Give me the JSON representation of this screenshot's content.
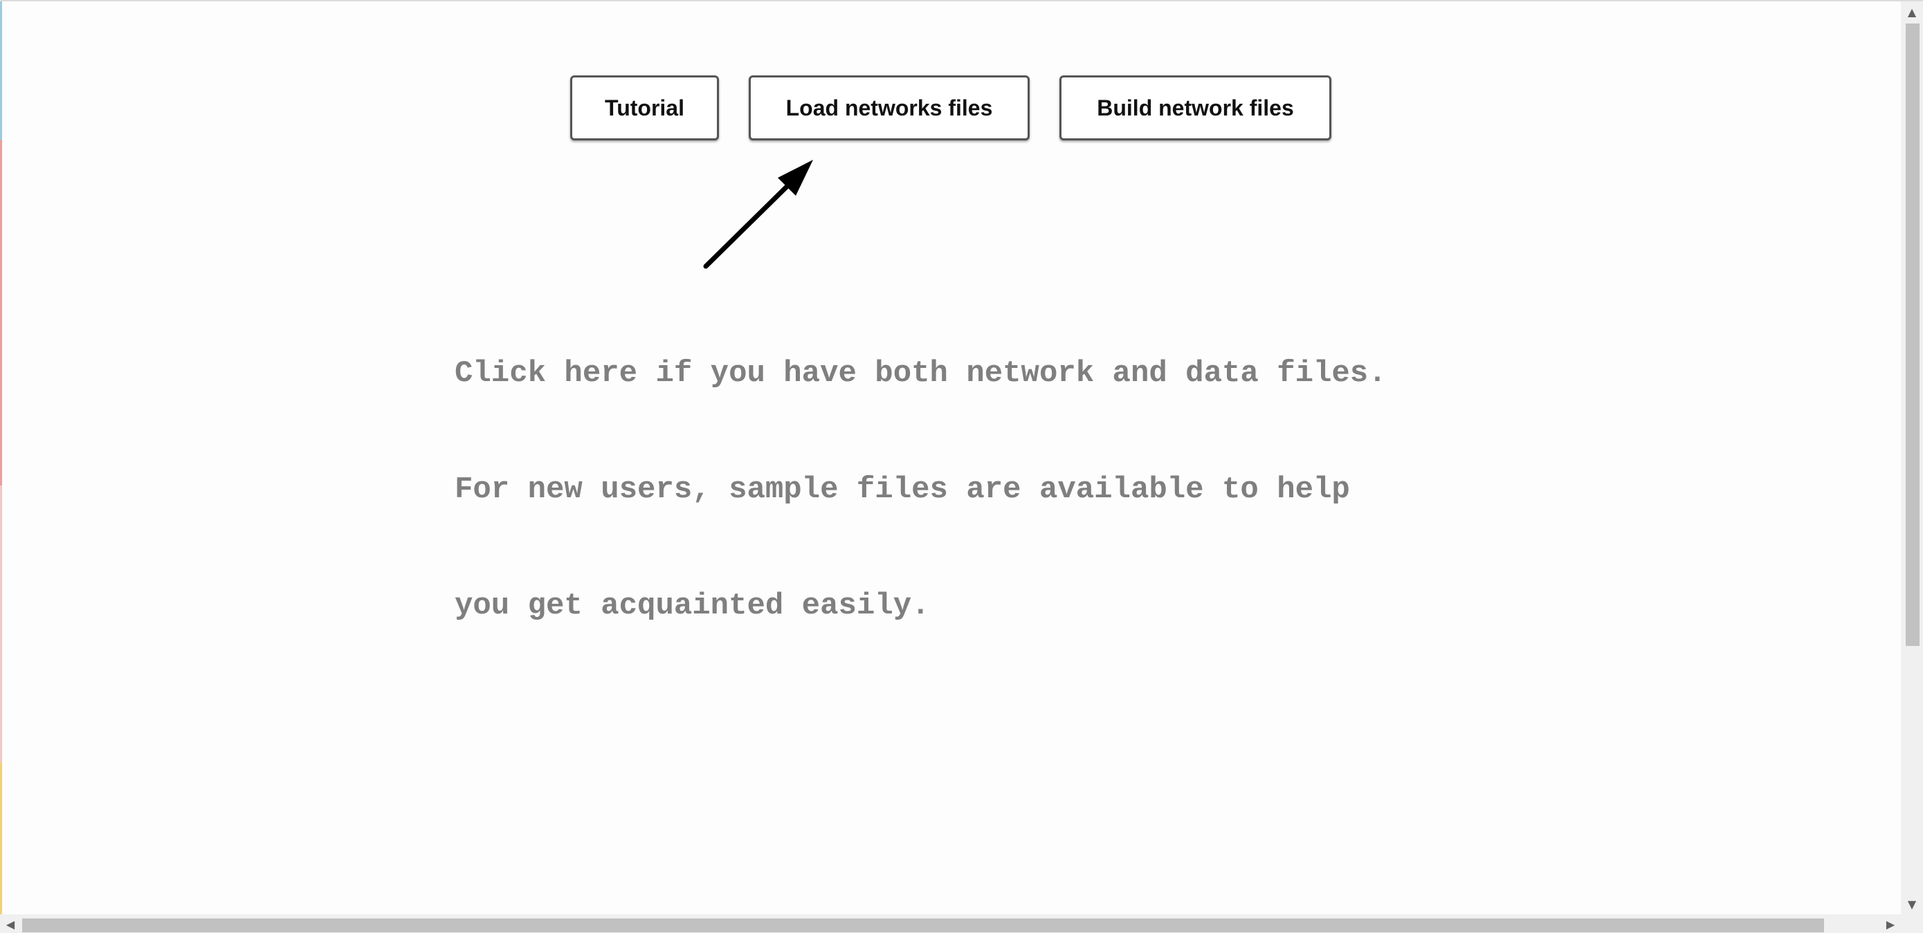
{
  "toolbar": {
    "tutorial_label": "Tutorial",
    "load_label": "Load networks files",
    "build_label": "Build network files"
  },
  "hint": {
    "lines": [
      "Click here if you have both network and data files.",
      "For new users, sample files are available to help",
      "you get acquainted easily."
    ]
  },
  "icons": {
    "pointer_arrow": "arrow-up-right-icon",
    "scroll_up": "chevron-up-icon",
    "scroll_down": "chevron-down-icon",
    "scroll_left": "chevron-left-icon",
    "scroll_right": "chevron-right-icon"
  },
  "colors": {
    "hint_text": "#7f7f7f",
    "button_border": "#555555",
    "arrow": "#000000"
  }
}
